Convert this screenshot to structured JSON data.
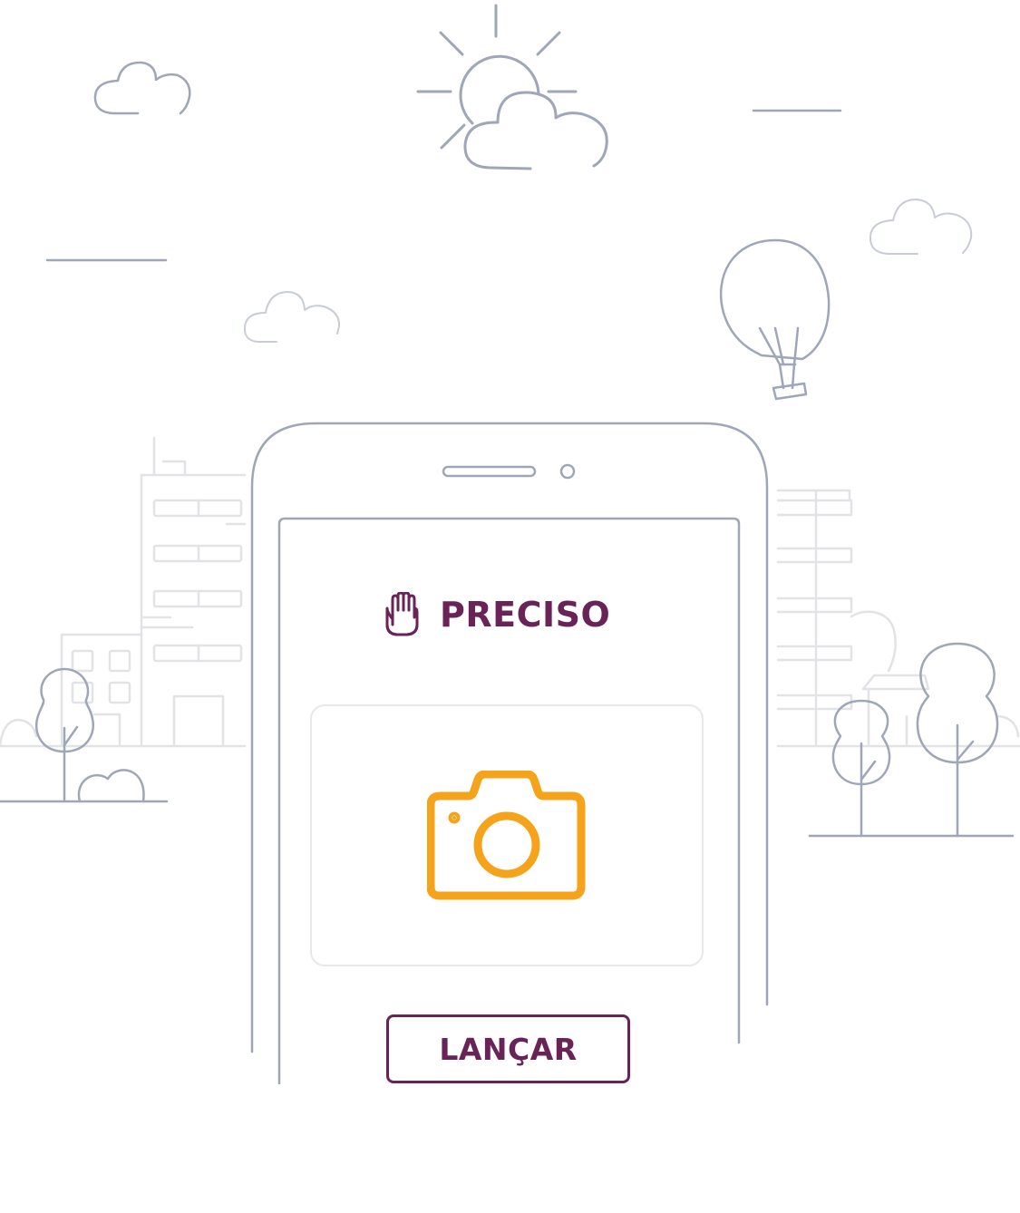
{
  "screen": {
    "title": "PRECISO",
    "title_icon": "raised-hand-icon",
    "photo_icon": "camera-icon",
    "action_label": "LANÇAR"
  },
  "colors": {
    "brand": "#6a2357",
    "camera": "#f5a31a",
    "illustration_line": "#9ea6b8",
    "illustration_light": "#e2e3e6"
  }
}
